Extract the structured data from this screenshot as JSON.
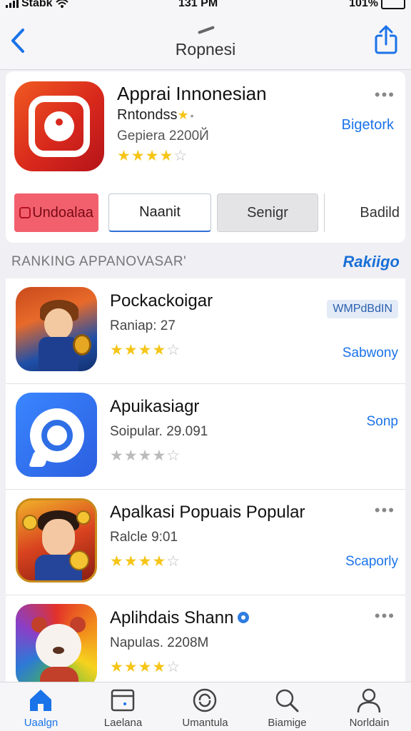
{
  "status": {
    "carrier": "Stabk",
    "time": "131 PM",
    "battery": "101%",
    "battery_level": 0.9
  },
  "nav": {
    "title": "Ropnesi"
  },
  "featured": {
    "name": "Apprai Innonesian",
    "subtitle": "Rntondss",
    "meta": "Gepiera 2200Й",
    "rating": 4,
    "get_label": "Bigetork",
    "segments": [
      "Undoalaa",
      "Naanit",
      "Senigr",
      "Badild"
    ]
  },
  "section": {
    "title": "RANKING APPANOVASAR'",
    "link": "Rakiigo"
  },
  "apps": [
    {
      "name": "Pockackoigar",
      "meta": "Raniap: 27",
      "rating": 4,
      "badge": "WMPdBdIN",
      "link": "Sabwony"
    },
    {
      "name": "Apuikasiagr",
      "meta": "Soipular. 29.091",
      "rating": 4,
      "link": "Sonp"
    },
    {
      "name": "Apalkasi Popuais Popular",
      "meta": "Ralcle 9:01",
      "rating": 4,
      "link": "Scaporly"
    },
    {
      "name": "Aplihdais Shann",
      "meta": "Napulas. 2208М",
      "rating": 4
    }
  ],
  "tabs": [
    "Uaalgn",
    "Laelana",
    "Umantula",
    "Biamige",
    "Norldain"
  ],
  "colors": {
    "accent": "#1a73e8",
    "star": "#f5c518",
    "segment_active": "#f2606e"
  }
}
